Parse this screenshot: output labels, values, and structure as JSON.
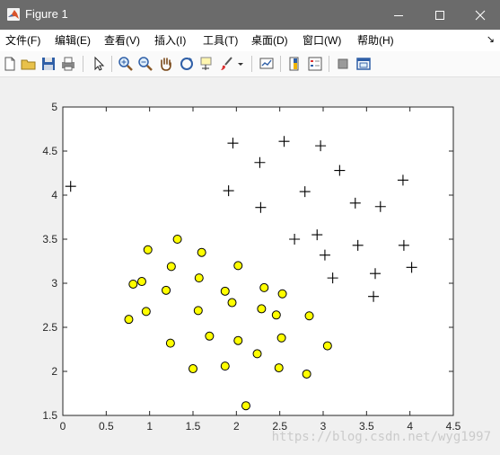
{
  "window": {
    "title": "Figure 1",
    "titlebar_color": "#6b6b6b"
  },
  "menu": {
    "items": [
      "文件(F)",
      "编辑(E)",
      "查看(V)",
      "插入(I)",
      "工具(T)",
      "桌面(D)",
      "窗口(W)",
      "帮助(H)"
    ]
  },
  "toolbar": {
    "icons": [
      "new-figure-icon",
      "open-file-icon",
      "save-icon",
      "print-icon",
      "edit-plot-arrow-icon",
      "zoom-in-icon",
      "zoom-out-icon",
      "pan-hand-icon",
      "rotate-3d-icon",
      "data-cursor-icon",
      "brush-icon",
      "link-plot-icon",
      "insert-colorbar-icon",
      "insert-legend-icon",
      "hide-plot-tools-icon",
      "show-plot-tools-icon"
    ]
  },
  "watermark": "https://blog.csdn.net/wyg1997",
  "chart_data": {
    "type": "scatter",
    "xlim": [
      0,
      4.5
    ],
    "ylim": [
      1.5,
      5
    ],
    "xticks": [
      "0",
      "0.5",
      "1",
      "1.5",
      "2",
      "2.5",
      "3",
      "3.5",
      "4",
      "4.5"
    ],
    "yticks": [
      "1.5",
      "2",
      "2.5",
      "3",
      "3.5",
      "4",
      "4.5",
      "5"
    ],
    "grid": false,
    "series": [
      {
        "marker": "plus",
        "color": "#000000",
        "points": [
          [
            0.09,
            4.1
          ],
          [
            1.96,
            4.59
          ],
          [
            2.55,
            4.61
          ],
          [
            2.97,
            4.56
          ],
          [
            2.27,
            4.37
          ],
          [
            3.19,
            4.28
          ],
          [
            3.92,
            4.17
          ],
          [
            1.91,
            4.05
          ],
          [
            2.79,
            4.04
          ],
          [
            3.37,
            3.91
          ],
          [
            3.66,
            3.87
          ],
          [
            2.28,
            3.86
          ],
          [
            2.67,
            3.5
          ],
          [
            2.93,
            3.55
          ],
          [
            3.4,
            3.43
          ],
          [
            3.93,
            3.43
          ],
          [
            3.02,
            3.32
          ],
          [
            4.02,
            3.18
          ],
          [
            3.6,
            3.11
          ],
          [
            3.11,
            3.06
          ],
          [
            3.58,
            2.85
          ]
        ]
      },
      {
        "marker": "circle",
        "color": "#ffff00",
        "edgecolor": "#000000",
        "points": [
          [
            1.32,
            3.5
          ],
          [
            0.98,
            3.38
          ],
          [
            1.6,
            3.35
          ],
          [
            1.25,
            3.19
          ],
          [
            2.02,
            3.2
          ],
          [
            1.57,
            3.06
          ],
          [
            0.81,
            2.99
          ],
          [
            0.91,
            3.02
          ],
          [
            1.19,
            2.92
          ],
          [
            1.87,
            2.91
          ],
          [
            2.32,
            2.95
          ],
          [
            2.53,
            2.88
          ],
          [
            1.95,
            2.78
          ],
          [
            0.96,
            2.68
          ],
          [
            1.56,
            2.69
          ],
          [
            2.29,
            2.71
          ],
          [
            2.46,
            2.64
          ],
          [
            2.84,
            2.63
          ],
          [
            0.76,
            2.59
          ],
          [
            1.69,
            2.4
          ],
          [
            2.02,
            2.35
          ],
          [
            2.52,
            2.38
          ],
          [
            1.24,
            2.32
          ],
          [
            3.05,
            2.29
          ],
          [
            2.24,
            2.2
          ],
          [
            1.87,
            2.06
          ],
          [
            1.5,
            2.03
          ],
          [
            2.49,
            2.04
          ],
          [
            2.81,
            1.97
          ],
          [
            2.11,
            1.61
          ]
        ]
      }
    ]
  }
}
